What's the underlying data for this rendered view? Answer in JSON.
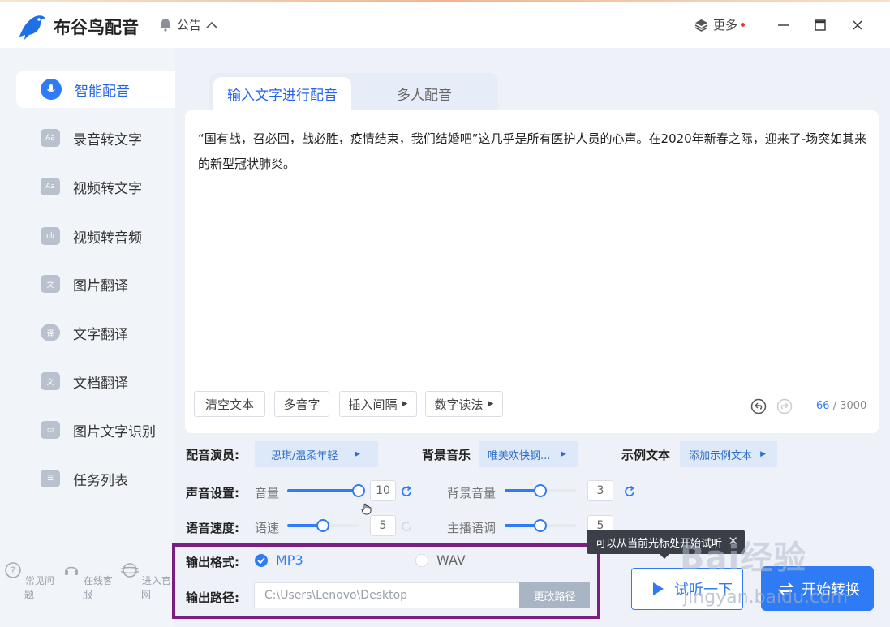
{
  "app": {
    "title": "布谷鸟配音",
    "notice_label": "公告",
    "more_label": "更多"
  },
  "sidebar": {
    "items": [
      {
        "label": "智能配音",
        "icon": "mic-icon",
        "active": true
      },
      {
        "label": "录音转文字",
        "icon": "audio-text-icon",
        "active": false
      },
      {
        "label": "视频转文字",
        "icon": "video-text-icon",
        "active": false
      },
      {
        "label": "视频转音频",
        "icon": "video-audio-icon",
        "active": false
      },
      {
        "label": "图片翻译",
        "icon": "image-translate-icon",
        "active": false
      },
      {
        "label": "文字翻译",
        "icon": "text-translate-icon",
        "active": false
      },
      {
        "label": "文档翻译",
        "icon": "doc-translate-icon",
        "active": false
      },
      {
        "label": "图片文字识别",
        "icon": "ocr-icon",
        "active": false
      },
      {
        "label": "任务列表",
        "icon": "task-list-icon",
        "active": false
      }
    ],
    "footer": [
      {
        "label": "常见问题",
        "icon": "question-icon"
      },
      {
        "label": "在线客服",
        "icon": "support-icon"
      },
      {
        "label": "进入官网",
        "icon": "website-icon"
      }
    ]
  },
  "tabs": [
    {
      "label": "输入文字进行配音",
      "active": true
    },
    {
      "label": "多人配音",
      "active": false
    }
  ],
  "editor": {
    "text": "“国有战，召必回，战必胜，疫情结束，我们结婚吧”这几乎是所有医护人员的心声。在2020年新春之际，迎来了-场突如其来的新型冠状肺炎。",
    "tools": [
      "清空文本",
      "多音字",
      "插入间隔",
      "数字读法"
    ],
    "count_current": "66",
    "count_max": "/ 3000"
  },
  "settings": {
    "voice_label": "配音演员:",
    "voice_value": "思琪/温柔年轻",
    "bgm_label": "背景音乐",
    "bgm_value": "唯美欢快钢...",
    "sample_label": "示例文本",
    "sample_value": "添加示例文本",
    "sound_label": "声音设置:",
    "volume_label": "音量",
    "volume_value": "10",
    "volume_fraction": 1.0,
    "bg_volume_label": "背景音量",
    "bg_volume_value": "3",
    "bg_volume_fraction": 0.5,
    "speed_section_label": "语音速度:",
    "speed_label": "语速",
    "speed_value": "5",
    "speed_fraction": 0.5,
    "pitch_label": "主播语调",
    "pitch_value": "5",
    "pitch_fraction": 0.5
  },
  "output": {
    "format_label": "输出格式:",
    "formats": [
      {
        "label": "MP3",
        "selected": true
      },
      {
        "label": "WAV",
        "selected": false
      }
    ],
    "path_label": "输出路径:",
    "path_value": "C:\\Users\\Lenovo\\Desktop",
    "change_path_label": "更改路径"
  },
  "actions": {
    "tooltip": "可以从当前光标处开始试听",
    "listen_label": "试听一下",
    "convert_label": "开始转换"
  },
  "watermark": {
    "main": "Bai经验",
    "sub": "jingyan.baidu.com"
  },
  "colors": {
    "accent": "#2f7bf5",
    "highlight_box": "#7a1e82"
  }
}
